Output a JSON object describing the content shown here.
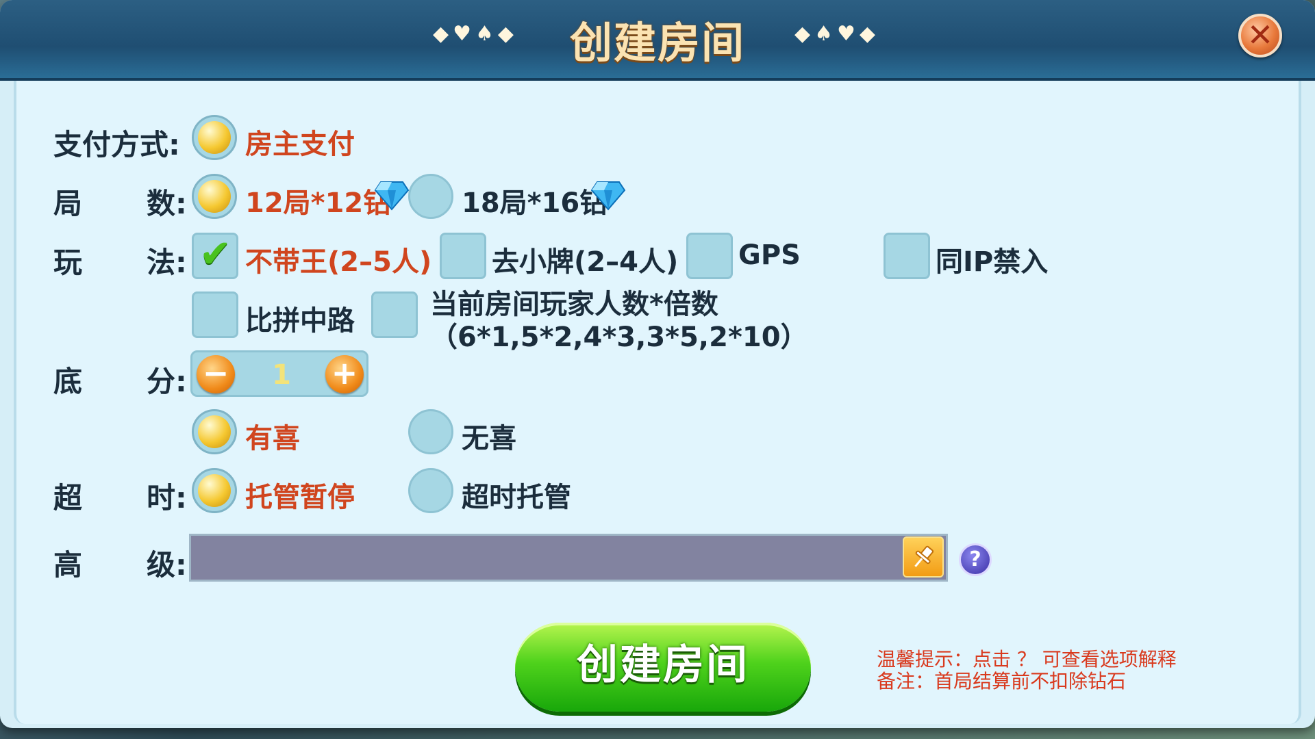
{
  "header": {
    "title": "创建房间",
    "suits_left": "◆♥♠◆",
    "suits_right": "◆♠♥◆",
    "close_icon": "close-x"
  },
  "payment": {
    "label": "支付方式:",
    "option": "房主支付",
    "selected": true
  },
  "rounds": {
    "label_a": "局",
    "label_b": "数:",
    "options": [
      {
        "text": "12局*12钻",
        "selected": true
      },
      {
        "text": "18局*16钻",
        "selected": false
      }
    ]
  },
  "rules": {
    "label_a": "玩",
    "label_b": "法:",
    "options": [
      {
        "text": "不带王(2–5人)",
        "checked": true
      },
      {
        "text": "去小牌(2–4人)",
        "checked": false
      },
      {
        "text": "GPS",
        "checked": false
      },
      {
        "text": "同IP禁入",
        "checked": false
      },
      {
        "text": "比拼中路",
        "checked": false
      },
      {
        "text": "当前房间玩家人数*倍数",
        "text2": "（6*1,5*2,4*3,3*5,2*10）",
        "checked": false
      }
    ]
  },
  "base_score": {
    "label_a": "底",
    "label_b": "分:",
    "value": "1",
    "minus": "−",
    "plus": "+"
  },
  "xi": {
    "options": [
      {
        "text": "有喜",
        "selected": true
      },
      {
        "text": "无喜",
        "selected": false
      }
    ]
  },
  "timeout": {
    "label_a": "超",
    "label_b": "时:",
    "options": [
      {
        "text": "托管暂停",
        "selected": true
      },
      {
        "text": "超时托管",
        "selected": false
      }
    ]
  },
  "advanced": {
    "label_a": "高",
    "label_b": "级:",
    "value": "",
    "help": "?"
  },
  "create_button": "创建房间",
  "tips": {
    "line1": "温馨提示：点击 ？ 可查看选项解释",
    "line2": "备注：首局结算前不扣除钻石"
  },
  "colors": {
    "selected_text": "#d0451e",
    "title_bar": "#1f4e72",
    "panel": "#e1f5fd",
    "create_green": "#4fd21c"
  }
}
